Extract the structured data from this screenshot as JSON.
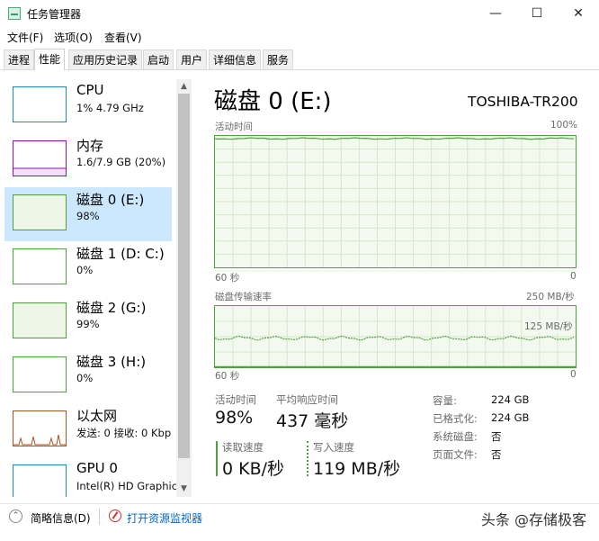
{
  "window": {
    "title": "任务管理器",
    "minimize_glyph": "—",
    "maximize_glyph": "☐",
    "close_glyph": "✕"
  },
  "menu": [
    "文件(F)",
    "选项(O)",
    "查看(V)"
  ],
  "tabs": [
    "进程",
    "性能",
    "应用历史记录",
    "启动",
    "用户",
    "详细信息",
    "服务"
  ],
  "active_tab": "性能",
  "sidebar": {
    "items": [
      {
        "title": "CPU",
        "sub": "1% 4.79 GHz",
        "color": "#1a8ac6"
      },
      {
        "title": "内存",
        "sub": "1.6/7.9 GB (20%)",
        "color": "#8b12ae"
      },
      {
        "title": "磁盘 0 (E:)",
        "sub": "98%",
        "color": "#4ca23f"
      },
      {
        "title": "磁盘 1 (D: C:)",
        "sub": "0%",
        "color": "#4ca23f"
      },
      {
        "title": "磁盘 2 (G:)",
        "sub": "99%",
        "color": "#4ca23f"
      },
      {
        "title": "磁盘 3 (H:)",
        "sub": "0%",
        "color": "#4ca23f"
      },
      {
        "title": "以太网",
        "sub": "发送: 0 接收: 0 Kbp",
        "color": "#a7561f"
      },
      {
        "title": "GPU 0",
        "sub": "Intel(R) HD Graphic",
        "color": "#1a8ac6"
      }
    ],
    "selected_index": 2
  },
  "main": {
    "title": "磁盘 0 (E:)",
    "device": "TOSHIBA-TR200",
    "activity_graph": {
      "label": "活动时间",
      "max_label": "100%",
      "x_left": "60 秒",
      "x_right": "0",
      "level_percent": 98
    },
    "transfer_graph": {
      "label": "磁盘传输速率",
      "max_label": "250 MB/秒",
      "mid_label": "125 MB/秒",
      "x_left": "60 秒",
      "x_right": "0",
      "level_mb": 119
    },
    "stats": {
      "active_time_label": "活动时间",
      "active_time_value": "98%",
      "response_label": "平均响应时间",
      "response_value": "437 毫秒",
      "read_label": "读取速度",
      "read_value": "0 KB/秒",
      "write_label": "写入速度",
      "write_value": "119 MB/秒"
    },
    "properties": [
      {
        "label": "容量:",
        "value": "224 GB"
      },
      {
        "label": "已格式化:",
        "value": "224 GB"
      },
      {
        "label": "系统磁盘:",
        "value": "否"
      },
      {
        "label": "页面文件:",
        "value": "否"
      }
    ]
  },
  "footer": {
    "summary_label": "简略信息(D)",
    "monitor_label": "打开资源监视器"
  },
  "watermark": "头条 @存储极客",
  "colors": {
    "disk_green": "#4ca23f",
    "selected_bg": "#cce8ff",
    "link_blue": "#0066cc"
  }
}
